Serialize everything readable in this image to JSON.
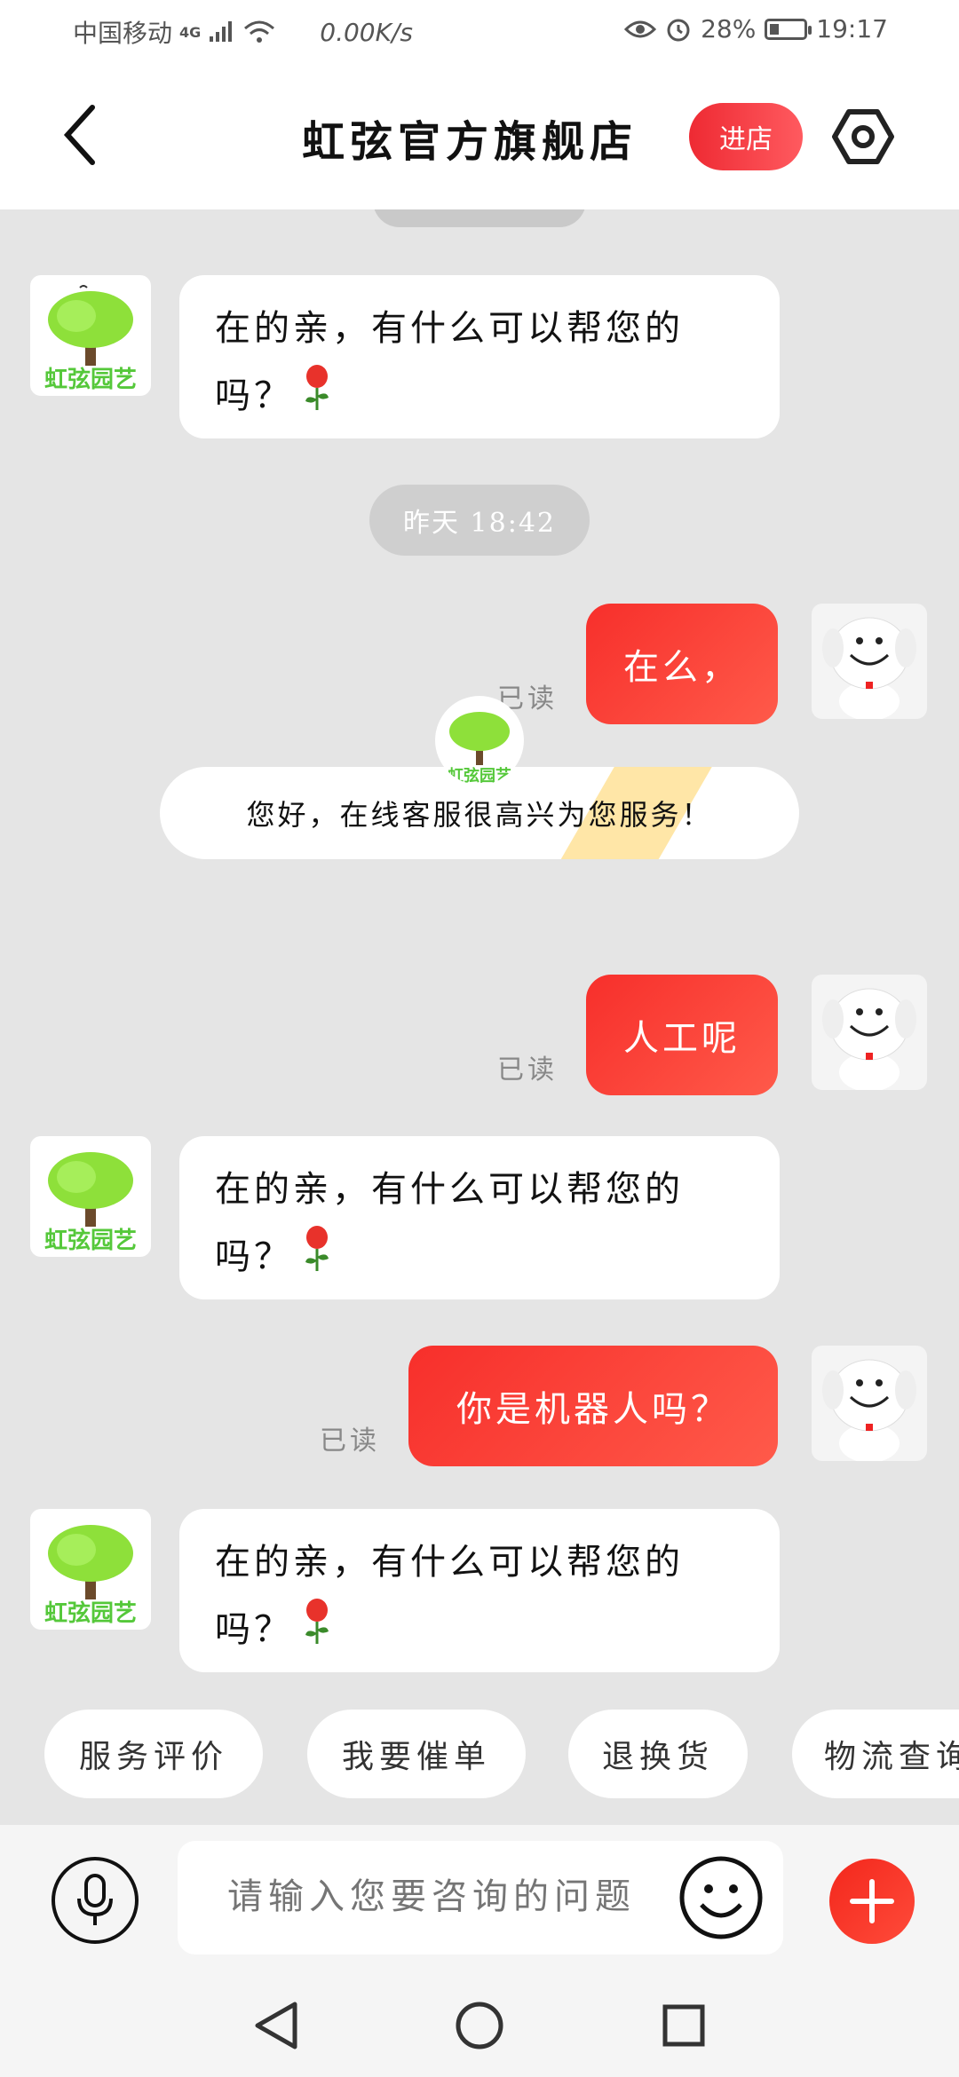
{
  "status_bar": {
    "carrier": "中国移动",
    "network": "4G",
    "speed": "0.00K/s",
    "battery": "28%",
    "time": "19:17",
    "battery_level": 0.28
  },
  "header": {
    "title": "虹弦官方旗舰店",
    "enter_store_label": "进店",
    "icons": {
      "back": "chevron-left-icon",
      "settings": "hexagon-settings-icon"
    }
  },
  "shop_avatar_text": "虹弦园艺",
  "messages": [
    {
      "from": "shop",
      "text": "在的亲，有什么可以帮您的吗？",
      "emoji": "rose"
    },
    {
      "type": "time",
      "text": "昨天 18:42"
    },
    {
      "from": "user",
      "text": "在么，",
      "status": "已读"
    },
    {
      "type": "system",
      "text": "您好，在线客服很高兴为您服务！"
    },
    {
      "from": "user",
      "text": "人工呢",
      "status": "已读"
    },
    {
      "from": "shop",
      "text": "在的亲，有什么可以帮您的吗？",
      "emoji": "rose"
    },
    {
      "from": "user",
      "text": "你是机器人吗？",
      "status": "已读"
    },
    {
      "from": "shop",
      "text": "在的亲，有什么可以帮您的吗？",
      "emoji": "rose"
    }
  ],
  "quick_replies": [
    "服务评价",
    "我要催单",
    "退换货",
    "物流查询"
  ],
  "input": {
    "placeholder": "请输入您要咨询的问题"
  },
  "colors": {
    "accent": "#f72f2b",
    "chat_bg": "#e5e5e5",
    "tree_green": "#7ed321"
  }
}
